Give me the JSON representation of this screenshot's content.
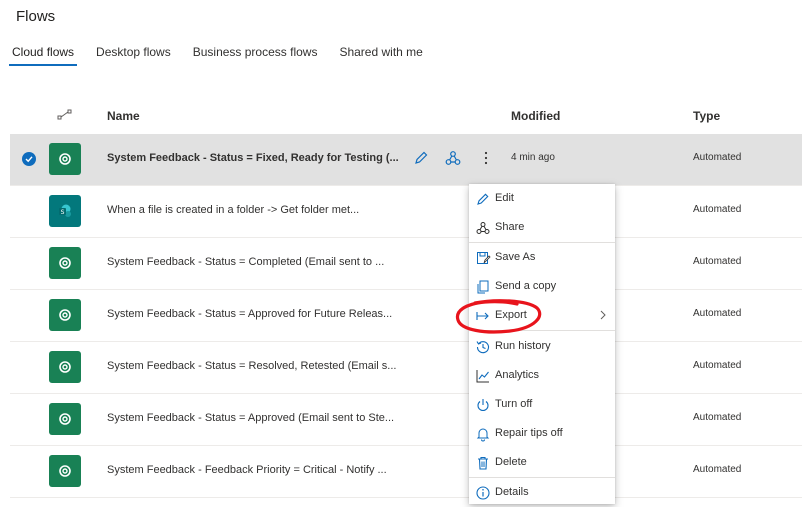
{
  "page": {
    "title": "Flows"
  },
  "tabs": [
    {
      "label": "Cloud flows",
      "active": true
    },
    {
      "label": "Desktop flows",
      "active": false
    },
    {
      "label": "Business process flows",
      "active": false
    },
    {
      "label": "Shared with me",
      "active": false
    }
  ],
  "table": {
    "headers": {
      "name": "Name",
      "modified": "Modified",
      "type": "Type"
    },
    "rows": [
      {
        "name": "System Feedback - Status = Fixed, Ready for Testing (...",
        "modified": "4 min ago",
        "type": "Automated",
        "icon": "power-automate-icon",
        "selected": true
      },
      {
        "name": "When a file is created in a folder -> Get folder met...",
        "modified": "",
        "type": "Automated",
        "icon": "sharepoint-icon",
        "selected": false
      },
      {
        "name": "System Feedback - Status = Completed (Email sent to ...",
        "modified": "",
        "type": "Automated",
        "icon": "power-automate-icon",
        "selected": false
      },
      {
        "name": "System Feedback - Status = Approved for Future Releas...",
        "modified": "",
        "type": "Automated",
        "icon": "power-automate-icon",
        "selected": false
      },
      {
        "name": "System Feedback - Status = Resolved, Retested (Email s...",
        "modified": "",
        "type": "Automated",
        "icon": "power-automate-icon",
        "selected": false
      },
      {
        "name": "System Feedback - Status = Approved (Email sent to Ste...",
        "modified": "",
        "type": "Automated",
        "icon": "power-automate-icon",
        "selected": false
      },
      {
        "name": "System Feedback - Feedback Priority = Critical - Notify ...",
        "modified": "",
        "type": "Automated",
        "icon": "power-automate-icon",
        "selected": false
      }
    ]
  },
  "context_menu": {
    "items": [
      {
        "label": "Edit",
        "icon": "pencil-icon"
      },
      {
        "label": "Share",
        "icon": "share-icon"
      },
      {
        "label": "Save As",
        "icon": "save-as-icon"
      },
      {
        "label": "Send a copy",
        "icon": "copy-icon"
      },
      {
        "label": "Export",
        "icon": "export-icon",
        "submenu": true
      },
      {
        "label": "Run history",
        "icon": "history-icon"
      },
      {
        "label": "Analytics",
        "icon": "analytics-icon"
      },
      {
        "label": "Turn off",
        "icon": "power-icon"
      },
      {
        "label": "Repair tips off",
        "icon": "bell-icon"
      },
      {
        "label": "Delete",
        "icon": "trash-icon"
      },
      {
        "label": "Details",
        "icon": "info-icon"
      }
    ]
  },
  "colors": {
    "accent": "#0f6cbd",
    "flow_icon_bg": "#198155",
    "sharepoint_icon_bg": "#03787c",
    "selected_row_bg": "#e1e1e1",
    "annotation": "#e8141c"
  }
}
